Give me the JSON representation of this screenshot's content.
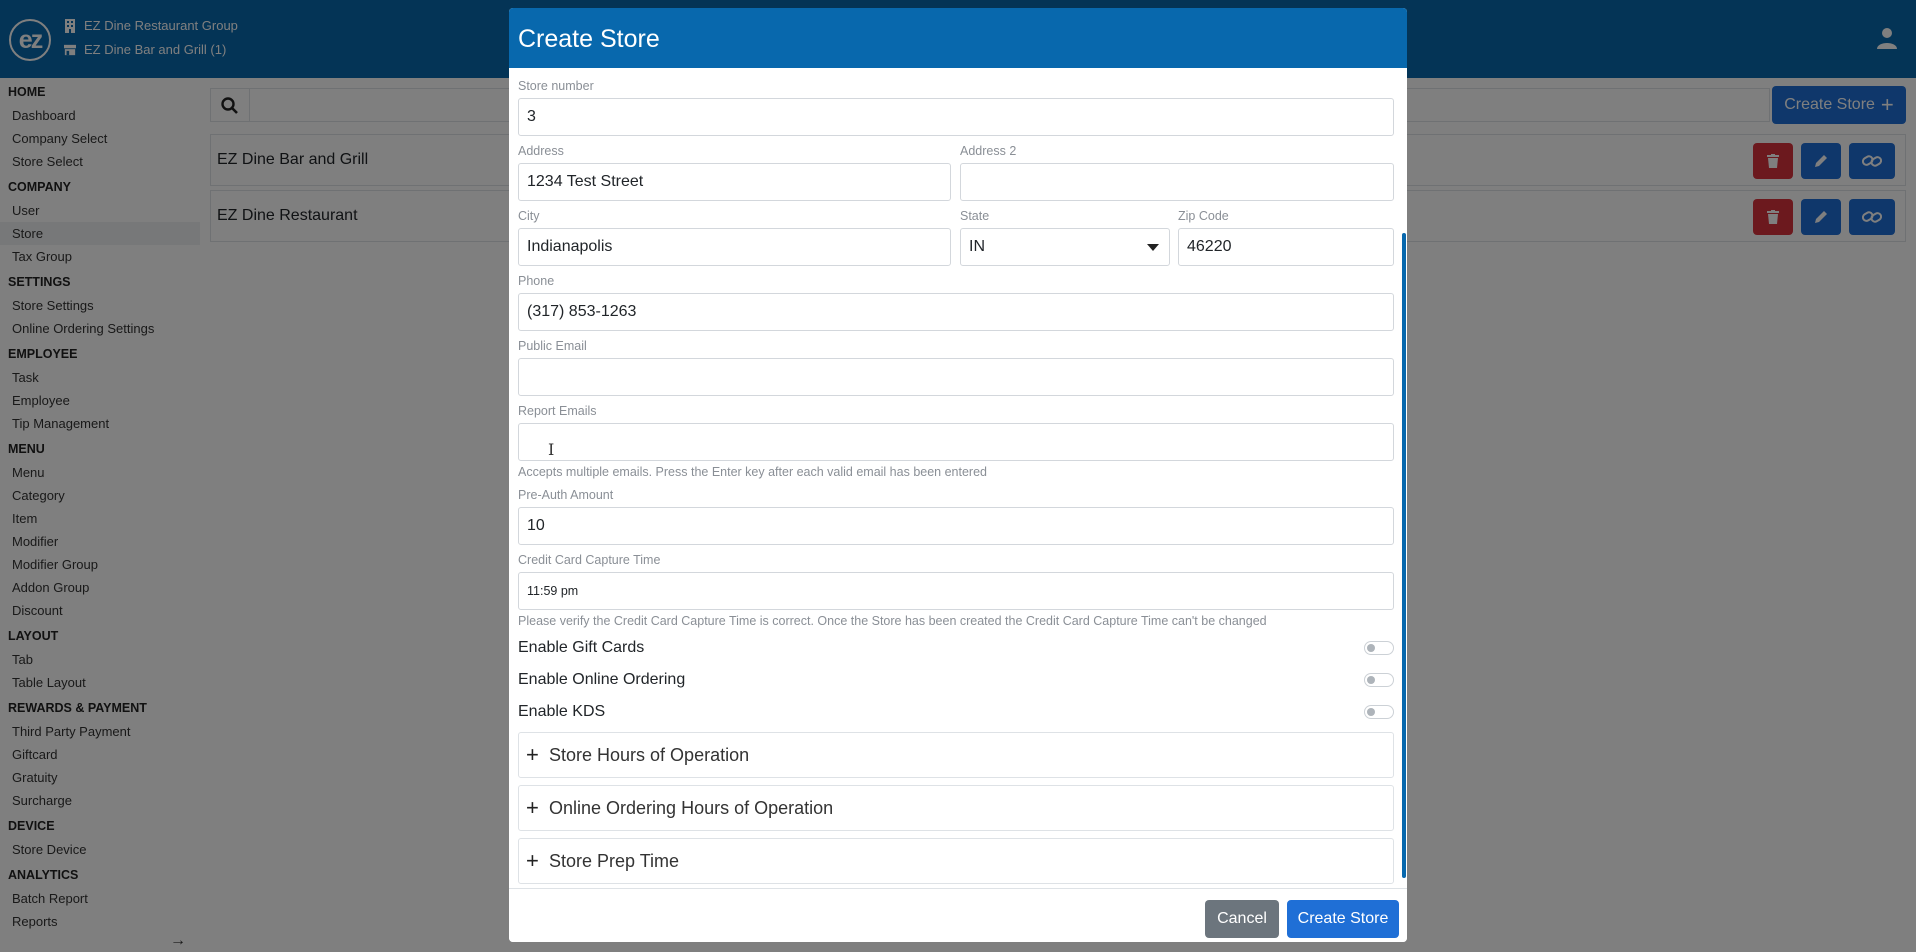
{
  "header": {
    "logo": "ez",
    "company": "EZ Dine Restaurant Group",
    "store": "EZ Dine Bar and Grill (1)"
  },
  "sidebar": {
    "sections": [
      {
        "title": "HOME",
        "items": [
          "Dashboard",
          "Company Select",
          "Store Select"
        ]
      },
      {
        "title": "COMPANY",
        "items": [
          "User",
          "Store",
          "Tax Group"
        ]
      },
      {
        "title": "SETTINGS",
        "items": [
          "Store Settings",
          "Online Ordering Settings"
        ]
      },
      {
        "title": "EMPLOYEE",
        "items": [
          "Task",
          "Employee",
          "Tip Management"
        ]
      },
      {
        "title": "MENU",
        "items": [
          "Menu",
          "Category",
          "Item",
          "Modifier",
          "Modifier Group",
          "Addon Group",
          "Discount"
        ]
      },
      {
        "title": "LAYOUT",
        "items": [
          "Tab",
          "Table Layout"
        ]
      },
      {
        "title": "REWARDS & PAYMENT",
        "items": [
          "Third Party Payment",
          "Giftcard",
          "Gratuity",
          "Surcharge"
        ]
      },
      {
        "title": "DEVICE",
        "items": [
          "Store Device"
        ]
      },
      {
        "title": "ANALYTICS",
        "items": [
          "Batch Report",
          "Reports"
        ]
      }
    ],
    "active": "Store"
  },
  "main": {
    "create_button": "Create Store",
    "stores": [
      "EZ Dine Bar and Grill",
      "EZ Dine Restaurant"
    ]
  },
  "modal": {
    "title": "Create Store",
    "fields": {
      "store_number": {
        "label": "Store number",
        "value": "3"
      },
      "address": {
        "label": "Address",
        "value": "1234 Test Street"
      },
      "address2": {
        "label": "Address 2",
        "value": ""
      },
      "city": {
        "label": "City",
        "value": "Indianapolis"
      },
      "state": {
        "label": "State",
        "value": "IN"
      },
      "zip": {
        "label": "Zip Code",
        "value": "46220"
      },
      "phone": {
        "label": "Phone",
        "value": "(317) 853-1263"
      },
      "public_email": {
        "label": "Public Email",
        "value": ""
      },
      "report_emails": {
        "label": "Report Emails",
        "value": "",
        "hint": "Accepts multiple emails. Press the Enter key after each valid email has been entered"
      },
      "preauth": {
        "label": "Pre-Auth Amount",
        "value": "10"
      },
      "capture_time": {
        "label": "Credit Card Capture Time",
        "value": "11:59 pm",
        "hint": "Please verify the Credit Card Capture Time is correct. Once the Store has been created the Credit Card Capture Time can't be changed"
      }
    },
    "toggles": [
      {
        "label": "Enable Gift Cards",
        "on": false
      },
      {
        "label": "Enable Online Ordering",
        "on": false
      },
      {
        "label": "Enable KDS",
        "on": false
      }
    ],
    "sections": [
      "Store Hours of Operation",
      "Online Ordering Hours of Operation",
      "Store Prep Time"
    ],
    "cancel_label": "Cancel",
    "submit_label": "Create Store"
  }
}
